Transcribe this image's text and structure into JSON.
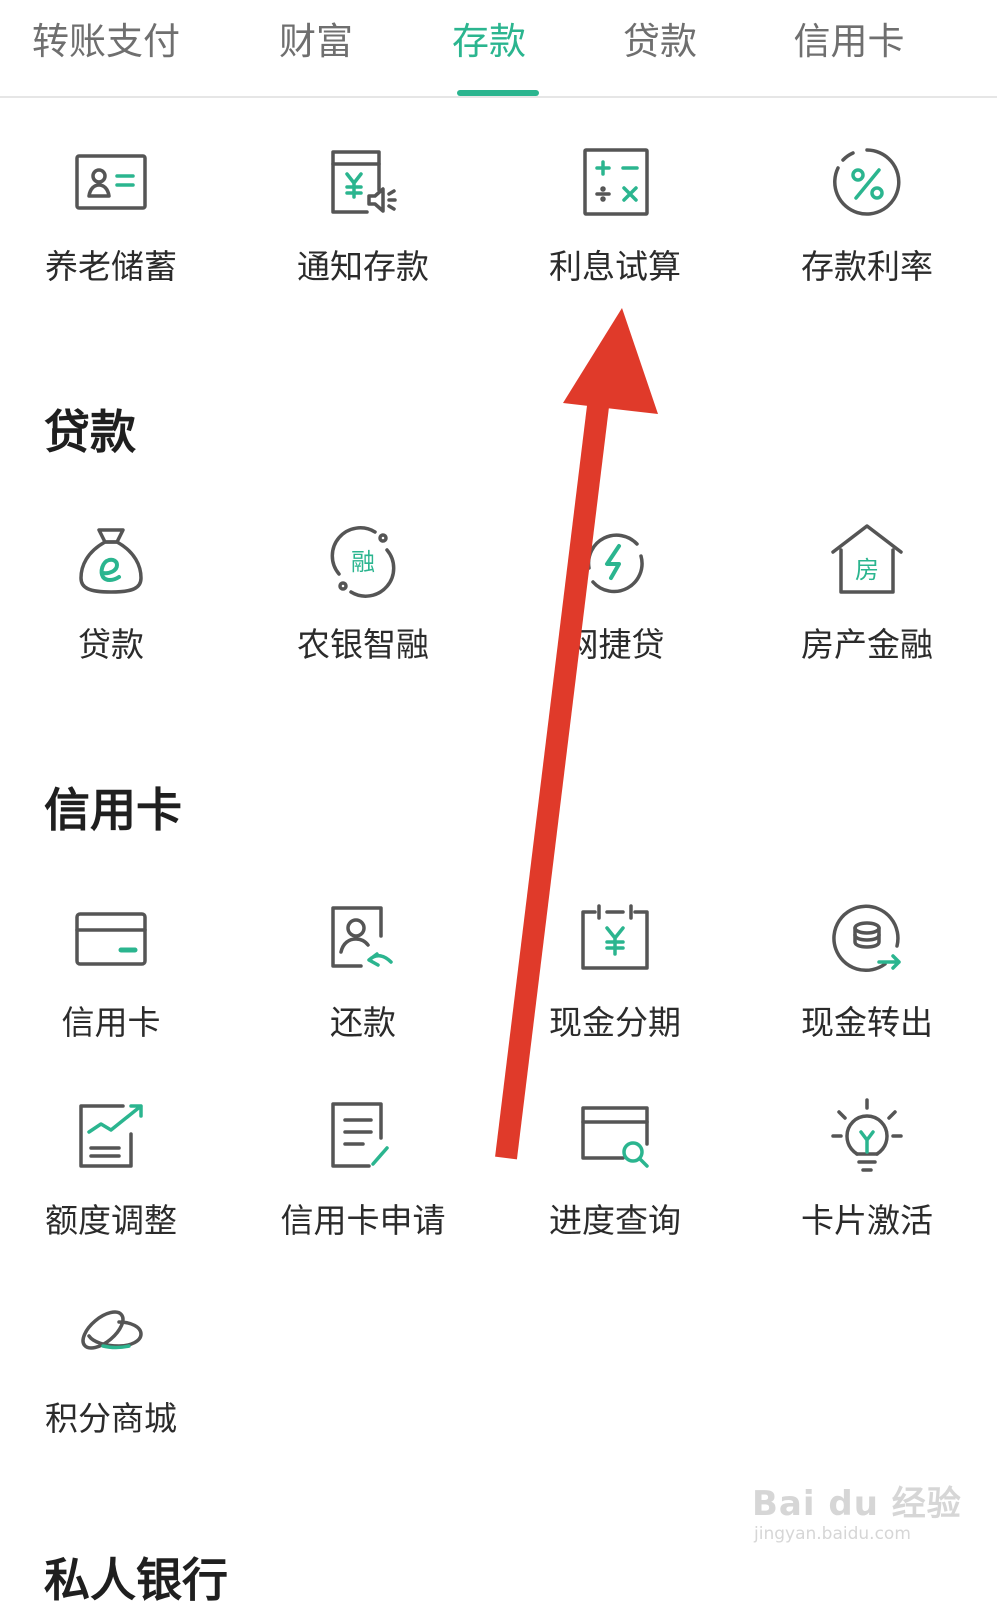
{
  "tabs": [
    {
      "label": "转账支付",
      "active": false
    },
    {
      "label": "财富",
      "active": false
    },
    {
      "label": "存款",
      "active": true
    },
    {
      "label": "贷款",
      "active": false
    },
    {
      "label": "信用卡",
      "active": false
    }
  ],
  "deposit": {
    "items": [
      {
        "label": "养老储蓄",
        "icon": "pension-savings-icon"
      },
      {
        "label": "通知存款",
        "icon": "notice-deposit-icon"
      },
      {
        "label": "利息试算",
        "icon": "calculator-icon"
      },
      {
        "label": "存款利率",
        "icon": "percent-icon"
      }
    ]
  },
  "loan": {
    "title": "贷款",
    "items": [
      {
        "label": "贷款",
        "icon": "money-bag-icon"
      },
      {
        "label": "农银智融",
        "icon": "smart-finance-icon"
      },
      {
        "label": "网捷贷",
        "icon": "lightning-loan-icon"
      },
      {
        "label": "房产金融",
        "icon": "house-icon"
      }
    ]
  },
  "credit": {
    "title": "信用卡",
    "items": [
      {
        "label": "信用卡",
        "icon": "credit-card-icon"
      },
      {
        "label": "还款",
        "icon": "repayment-icon"
      },
      {
        "label": "现金分期",
        "icon": "installment-icon"
      },
      {
        "label": "现金转出",
        "icon": "cash-transfer-icon"
      },
      {
        "label": "额度调整",
        "icon": "limit-adjust-icon"
      },
      {
        "label": "信用卡申请",
        "icon": "card-application-icon"
      },
      {
        "label": "进度查询",
        "icon": "progress-query-icon"
      },
      {
        "label": "卡片激活",
        "icon": "card-activation-icon"
      },
      {
        "label": "积分商城",
        "icon": "points-mall-icon"
      }
    ]
  },
  "private_banking": {
    "title": "私人银行"
  },
  "watermark": {
    "main": "Bai du 经验",
    "sub": "jingyan.baidu.com"
  },
  "colors": {
    "accent": "#2bb58f",
    "icon_stroke": "#555555",
    "arrow": "#e03a2a"
  }
}
